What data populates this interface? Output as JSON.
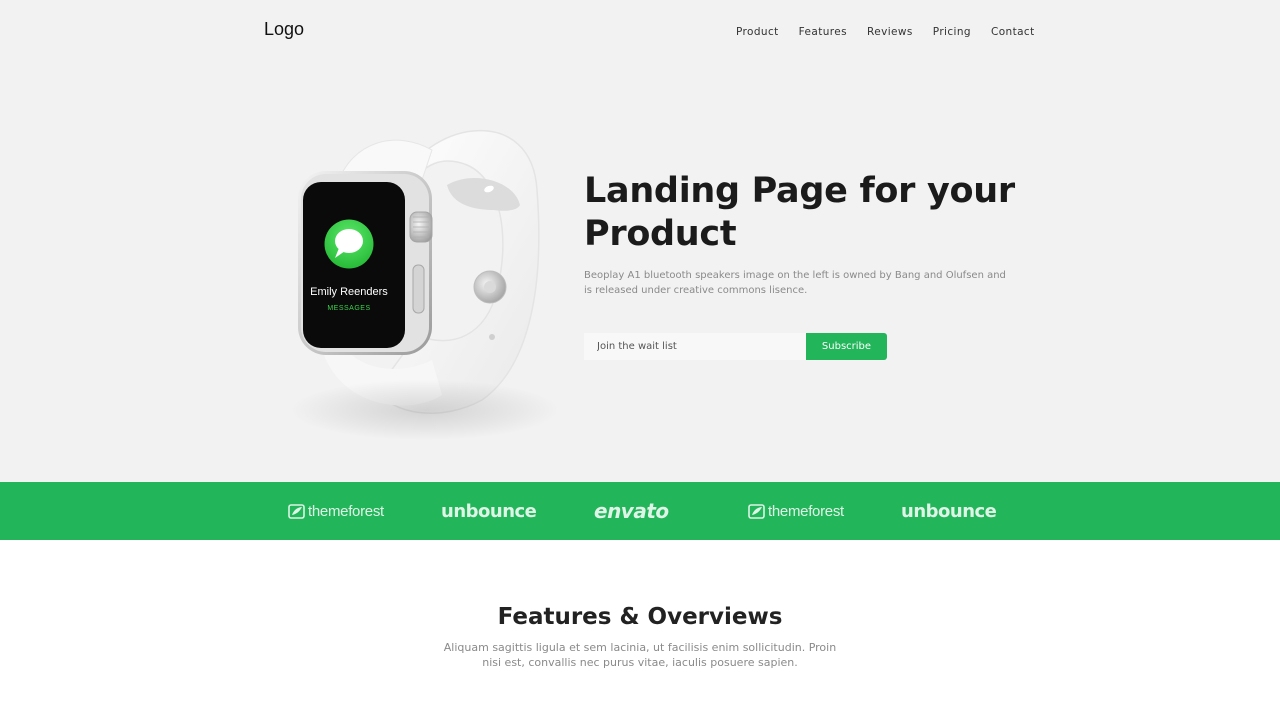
{
  "header": {
    "logo": "Logo",
    "nav": [
      "Product",
      "Features",
      "Reviews",
      "Pricing",
      "Contact"
    ]
  },
  "hero": {
    "watch": {
      "contact_name": "Emily Reenders",
      "app_label": "MESSAGES"
    },
    "title": "Landing Page for your Product",
    "description": "Beoplay A1 bluetooth speakers image on the left is owned by Bang and Olufsen and is released under creative commons lisence.",
    "signup": {
      "placeholder": "Join the wait list",
      "button_label": "Subscribe"
    }
  },
  "brands": {
    "items": [
      "themeforest",
      "unbounce",
      "envato",
      "themeforest",
      "unbounce"
    ]
  },
  "features": {
    "title": "Features & Overviews",
    "description": "Aliquam sagittis ligula et sem lacinia, ut facilisis enim sollicitudin. Proin nisi est, convallis nec purus vitae, iaculis posuere sapien."
  },
  "colors": {
    "accent": "#22b55a",
    "hero_background": "#f2f2f2",
    "messages_icon": "#2fc840"
  }
}
